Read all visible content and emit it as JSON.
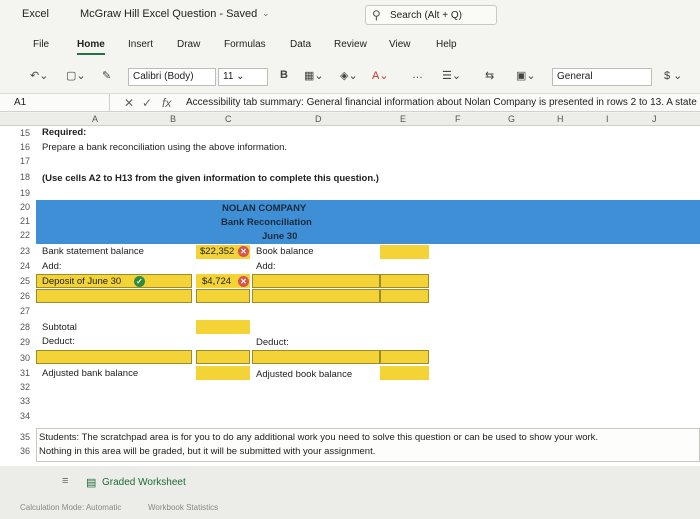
{
  "titlebar": {
    "app": "Excel",
    "document": "McGraw Hill Excel Question - Saved",
    "search": "Search (Alt + Q)"
  },
  "menu": [
    "File",
    "Home",
    "Insert",
    "Draw",
    "Formulas",
    "Data",
    "Review",
    "View",
    "Help"
  ],
  "active_tab": "Home",
  "ribbon": {
    "font": "Calibri (Body)",
    "size": "11",
    "bold": "B",
    "number_format": "General",
    "currency": "$"
  },
  "formula_bar": {
    "cell_ref": "A1",
    "fx": "fx",
    "content": "Accessibility tab summary: General financial information about Nolan Company is presented in rows 2 to 13. A state"
  },
  "columns": [
    "A",
    "B",
    "C",
    "D",
    "E",
    "F",
    "G",
    "H",
    "I",
    "J"
  ],
  "rows": [
    "15",
    "16",
    "17",
    "18",
    "19",
    "20",
    "21",
    "22",
    "23",
    "24",
    "25",
    "26",
    "27",
    "28",
    "29",
    "30",
    "31",
    "32",
    "33",
    "34",
    "35",
    "36"
  ],
  "sheet": {
    "required": "Required:",
    "instruction": "Prepare a bank reconciliation using the above information.",
    "use_cells": "(Use cells A2 to H13 from the given information to complete this question.)",
    "company": "NOLAN COMPANY",
    "statement": "Bank Reconciliation",
    "date": "June 30",
    "bank_balance_label": "Bank statement balance",
    "bank_balance_value": "$22,352",
    "book_balance_label": "Book balance",
    "add_left": "Add:",
    "add_right": "Add:",
    "deposit_label": "Deposit of June 30",
    "deposit_value": "$4,724",
    "subtotal": "Subtotal",
    "deduct_left": "Deduct:",
    "deduct_right": "Deduct:",
    "adjusted_bank": "Adjusted bank balance",
    "adjusted_book": "Adjusted book balance",
    "scratch_line1": "Students: The scratchpad area is for you to do any additional work you need to solve this question or can be used to show your work.",
    "scratch_line2": "Nothing in this area will be graded, but it will be submitted with your assignment."
  },
  "sheet_tab": "Graded Worksheet",
  "status": {
    "calc": "Calculation Mode: Automatic",
    "stats": "Workbook Statistics"
  }
}
